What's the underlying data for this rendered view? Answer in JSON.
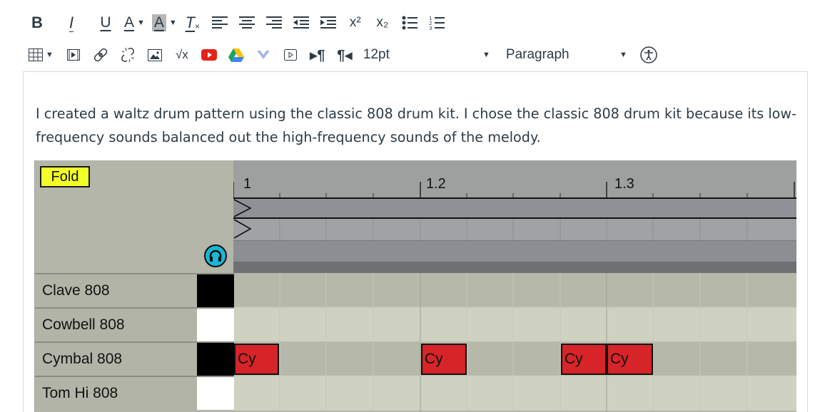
{
  "toolbar": {
    "bold": "B",
    "italic": "I",
    "underline": "U",
    "text_color": "A",
    "bg_color": "A",
    "clear_format": "T",
    "superscript": "x²",
    "subscript": "x₂",
    "font_size": "12pt",
    "block_format": "Paragraph"
  },
  "content": {
    "paragraph": " I created a waltz drum pattern using the classic 808 drum kit. I chose the classic 808 drum kit because its low-frequency sounds balanced out the high-frequency sounds of the melody."
  },
  "sequencer": {
    "fold_label": "Fold",
    "ruler": [
      "1",
      "1.2",
      "1.3"
    ],
    "tracks": [
      {
        "name": "Clave 808",
        "state": "black"
      },
      {
        "name": "Cowbell 808",
        "state": "white"
      },
      {
        "name": "Cymbal 808",
        "state": "black"
      },
      {
        "name": "Tom Hi 808",
        "state": "white"
      }
    ],
    "notes": [
      "Cy",
      "Cy",
      "Cy",
      "Cy"
    ],
    "colors": {
      "note": "#d62428",
      "fold": "#f3ff28",
      "headphone": "#19b6d7"
    }
  }
}
